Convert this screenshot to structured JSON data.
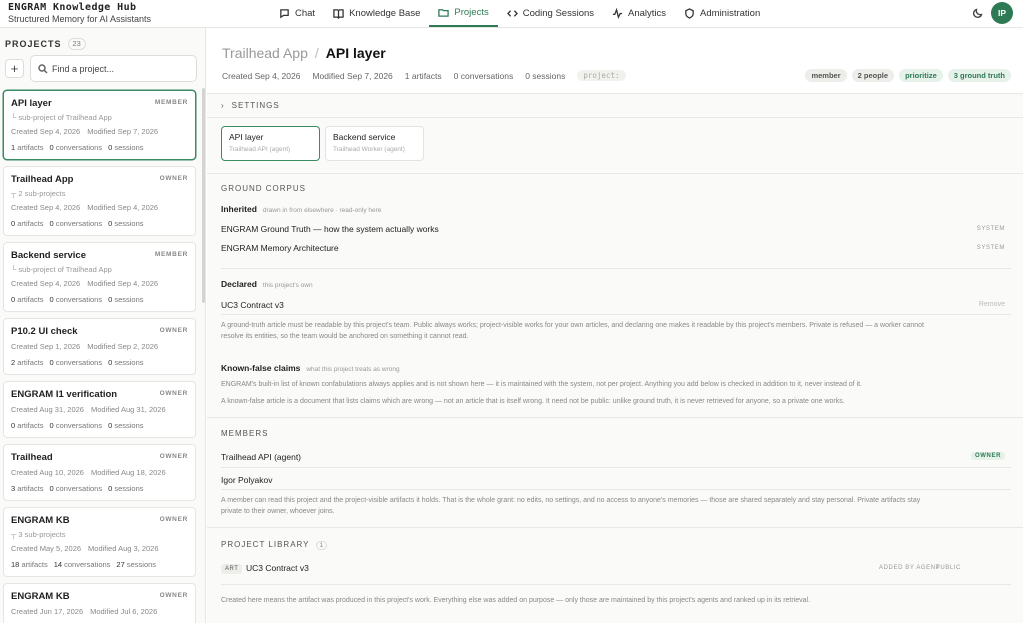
{
  "brand": {
    "title": "ENGRAM Knowledge Hub",
    "subtitle": "Structured Memory for AI Assistants"
  },
  "nav": [
    {
      "label": "Chat",
      "icon": "chat-icon"
    },
    {
      "label": "Knowledge Base",
      "icon": "book-icon"
    },
    {
      "label": "Projects",
      "icon": "folder-icon",
      "active": true
    },
    {
      "label": "Coding Sessions",
      "icon": "code-icon"
    },
    {
      "label": "Analytics",
      "icon": "activity-icon"
    },
    {
      "label": "Administration",
      "icon": "shield-icon"
    }
  ],
  "user": {
    "initials": "IP"
  },
  "colors": {
    "accent": "#2d7a55",
    "accent_soft": "#e6f1ea"
  },
  "sidebar": {
    "title": "PROJECTS",
    "count": "23",
    "add_label": "+",
    "search_placeholder": "Find a project...",
    "projects": [
      {
        "name": "API layer",
        "role": "MEMBER",
        "sub": "└ sub-project of Trailhead App",
        "created": "Created Sep 4, 2026",
        "modified": "Modified Sep 7, 2026",
        "artifacts": "1",
        "conversations": "0",
        "sessions": "0",
        "selected": true
      },
      {
        "name": "Trailhead App",
        "role": "OWNER",
        "sub": "┬ 2 sub-projects",
        "created": "Created Sep 4, 2026",
        "modified": "Modified Sep 4, 2026",
        "artifacts": "0",
        "conversations": "0",
        "sessions": "0"
      },
      {
        "name": "Backend service",
        "role": "MEMBER",
        "sub": "└ sub-project of Trailhead App",
        "created": "Created Sep 4, 2026",
        "modified": "Modified Sep 4, 2026",
        "artifacts": "0",
        "conversations": "0",
        "sessions": "0"
      },
      {
        "name": "P10.2 UI check",
        "role": "OWNER",
        "sub": "",
        "created": "Created Sep 1, 2026",
        "modified": "Modified Sep 2, 2026",
        "artifacts": "2",
        "conversations": "0",
        "sessions": "0"
      },
      {
        "name": "ENGRAM I1 verification",
        "role": "OWNER",
        "sub": "",
        "created": "Created Aug 31, 2026",
        "modified": "Modified Aug 31, 2026",
        "artifacts": "0",
        "conversations": "0",
        "sessions": "0"
      },
      {
        "name": "Trailhead",
        "role": "OWNER",
        "sub": "",
        "created": "Created Aug 10, 2026",
        "modified": "Modified Aug 18, 2026",
        "artifacts": "3",
        "conversations": "0",
        "sessions": "0"
      },
      {
        "name": "ENGRAM KB",
        "role": "OWNER",
        "sub": "┬ 3 sub-projects",
        "created": "Created May 5, 2026",
        "modified": "Modified Aug 3, 2026",
        "artifacts": "18",
        "conversations": "14",
        "sessions": "27"
      },
      {
        "name": "ENGRAM KB",
        "role": "OWNER",
        "sub": "",
        "created": "Created Jun 17, 2026",
        "modified": "Modified Jul 6, 2026",
        "artifacts": "20",
        "conversations": "13",
        "sessions": "0"
      }
    ],
    "stat_labels": {
      "artifacts": "artifacts",
      "conversations": "conversations",
      "sessions": "sessions"
    }
  },
  "project": {
    "parent": "Trailhead App",
    "separator": "/",
    "name": "API layer",
    "created": "Created Sep 4, 2026",
    "modified": "Modified Sep 7, 2026",
    "artifacts": "1 artifacts",
    "conversations": "0 conversations",
    "sessions": "0 sessions",
    "code_chip": "project:",
    "tags": [
      "member",
      "2 people",
      "prioritize",
      "3 ground truth"
    ]
  },
  "settings_label": "SETTINGS",
  "subprojects": [
    {
      "name": "API layer",
      "agent": "Trailhead API (agent)"
    },
    {
      "name": "Backend service",
      "agent": "Trailhead Worker (agent)"
    }
  ],
  "ground_corpus": {
    "title": "GROUND CORPUS",
    "inherited_label": "Inherited",
    "inherited_note": "drawn in from elsewhere · read-only here",
    "inherited_items": [
      {
        "title": "ENGRAM Ground Truth — how the system actually works",
        "source": "SYSTEM"
      },
      {
        "title": "ENGRAM Memory Architecture",
        "source": "SYSTEM"
      }
    ],
    "declared_label": "Declared",
    "declared_note": "this project's own",
    "declared_items": [
      {
        "title": "UC3 Contract v3",
        "action": "Remove"
      }
    ],
    "explain_1": "A ground-truth article must be readable by this project's team. Public always works; project-visible works for your own articles, and declaring one makes it readable by this project's members. Private is refused — a worker cannot",
    "explain_2": "resolve its entities, so the team would be anchored on something it cannot read."
  },
  "known_false": {
    "label": "Known-false claims",
    "note": "what this project treats as wrong",
    "para_1": "ENGRAM's built-in list of known confabulations always applies and is not shown here — it is maintained with the system, not per project. Anything you add below is checked in addition to it, never instead of it.",
    "para_2": "A known-false article is a document that lists claims which are wrong — not an article that is itself wrong. It need not be public: unlike ground truth, it is never retrieved for anyone, so a private one works."
  },
  "members": {
    "title": "MEMBERS",
    "items": [
      {
        "name": "Trailhead API (agent)",
        "badge": "OWNER"
      },
      {
        "name": "Igor Polyakov",
        "badge": ""
      }
    ],
    "para_1": "A member can read this project and the project-visible artifacts it holds. That is the whole grant: no edits, no settings, and no access to anyone's memories — those are shared separately and stay personal. Private artifacts stay",
    "para_2": "private to their owner, whoever joins."
  },
  "library": {
    "title": "PROJECT LIBRARY",
    "count": "1",
    "items": [
      {
        "type": "ART",
        "title": "UC3 Contract v3",
        "added": "ADDED BY AGENT",
        "visibility": "PUBLIC"
      }
    ],
    "note": "Created here means the artifact was produced in this project's work. Everything else was added on purpose — only those are maintained by this project's agents and ranked up in its retrieval."
  }
}
